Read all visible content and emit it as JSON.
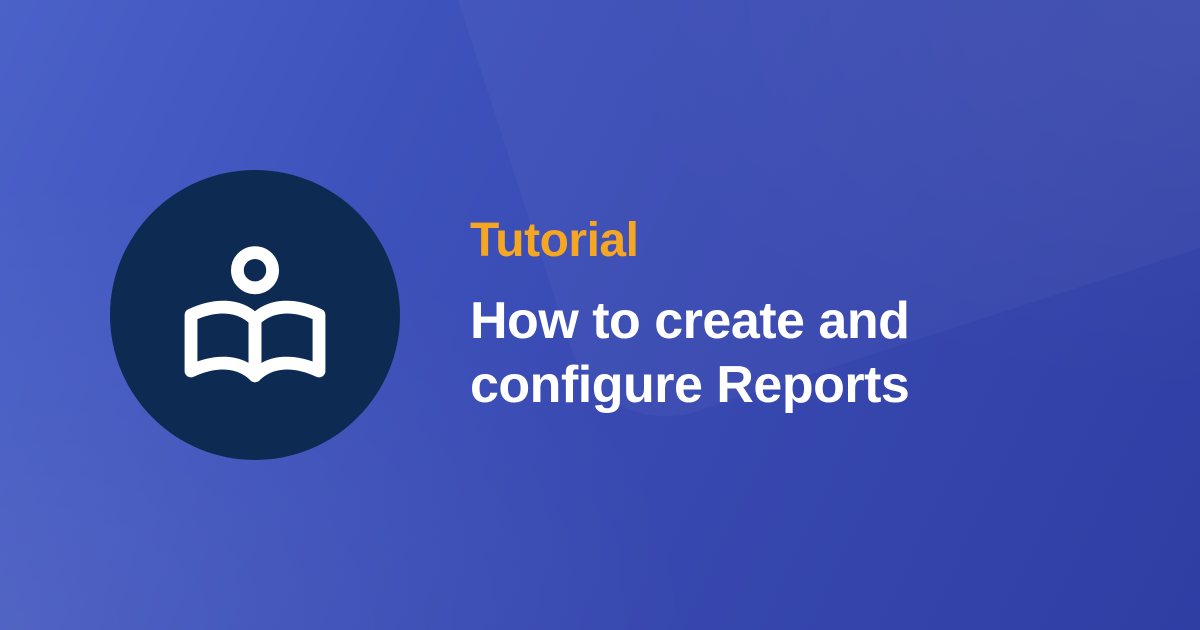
{
  "eyebrow": "Tutorial",
  "title": "How to create and configure Reports",
  "icon": "reader-book-icon",
  "colors": {
    "accent": "#f5a623",
    "circle_bg": "#0d2a52",
    "text": "#ffffff"
  }
}
